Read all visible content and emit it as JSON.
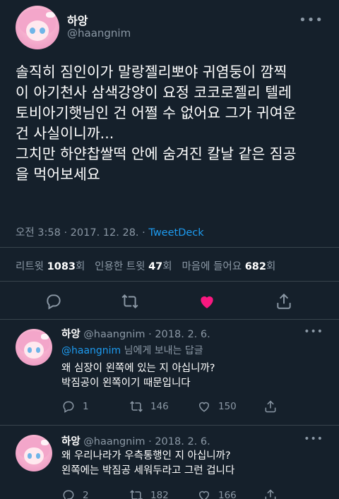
{
  "tweet": {
    "name": "하앙",
    "handle": "@haangnim",
    "text_lines": [
      "솔직히 짐인이가 말랑젤리뽀야 귀염둥이 깜찍",
      "이 아기천사 삼색강양이 요정 코코로젤리 텔레",
      "토비아기햇님인 건 어쩔 수 없어요 그가 귀여운",
      "건 사실이니까...",
      "그치만 하얀찹쌀떡 안에 숨겨진 칼날 같은 짐공",
      "을 먹어보세요"
    ],
    "time": "오전 3:58 · 2017. 12. 28. · ",
    "source": "TweetDeck",
    "stats": {
      "retweet_label": "리트윗 ",
      "retweet_count": "1083",
      "retweet_unit": "회",
      "quote_label": "인용한 트윗 ",
      "quote_count": "47",
      "quote_unit": "회",
      "like_label": "마음에 들어요 ",
      "like_count": "682",
      "like_unit": "회"
    },
    "icons": [
      "reply-icon",
      "retweet-icon",
      "like-icon-filled",
      "share-icon"
    ],
    "like_color": "#f91880"
  },
  "replies": [
    {
      "name": "하앙",
      "handle_date": "@haangnim · 2018. 2. 6.",
      "mention": "@haangnim",
      "mention_suffix": " 님에게 보내는 답글",
      "lines": [
        "왜 심장이 왼쪽에 있는 지 아십니까?",
        "박짐공이 왼쪽이기 때문입니다"
      ],
      "replies": "1",
      "retweets": "146",
      "likes": "150"
    },
    {
      "name": "하앙",
      "handle_date": "@haangnim · 2018. 2. 6.",
      "lines": [
        "왜 우리나라가 우측통행인 지 아십니까?",
        "왼쪽에는 박짐공 세워두라고 그런 겁니다"
      ],
      "replies": "2",
      "retweets": "182",
      "likes": "166"
    }
  ],
  "colors": {
    "background": "#15202b",
    "muted": "#8b98a5",
    "accent": "#1d9bf0",
    "divider": "#38444d"
  }
}
